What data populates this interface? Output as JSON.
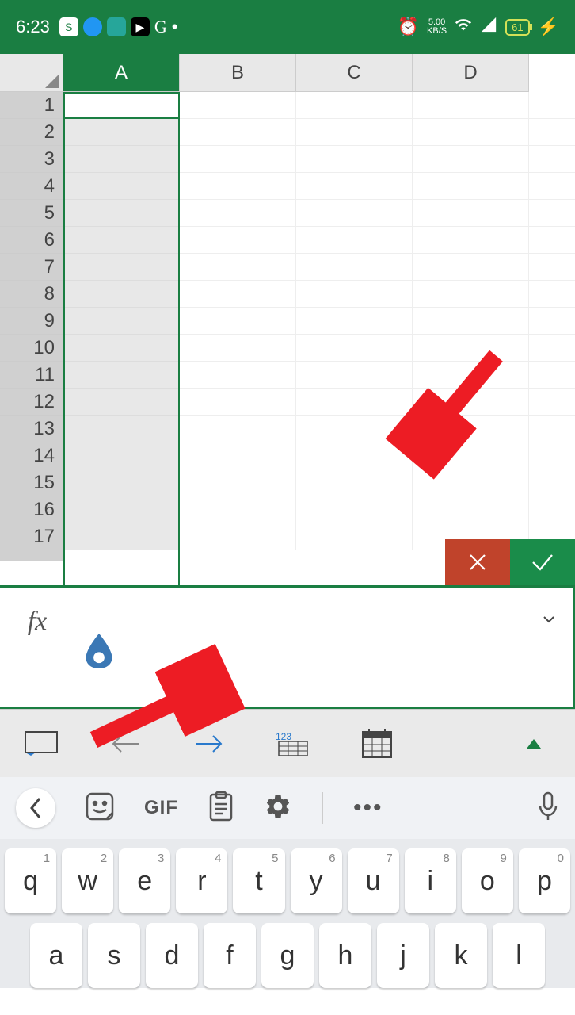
{
  "status_bar": {
    "time": "6:23",
    "icons": [
      "S",
      "leaf",
      "square",
      "play",
      "G"
    ],
    "net_speed_value": "5.00",
    "net_speed_unit": "KB/S",
    "battery": "61"
  },
  "spreadsheet": {
    "columns": [
      "A",
      "B",
      "C",
      "D"
    ],
    "selected_column": "A",
    "rows": [
      1,
      2,
      3,
      4,
      5,
      6,
      7,
      8,
      9,
      10,
      11,
      12,
      13,
      14,
      15,
      16,
      17
    ],
    "active_cell": "A1"
  },
  "formula_bar": {
    "fx_label": "fx",
    "value": ""
  },
  "toolbar": {
    "items": [
      "keyboard-mode",
      "nav-left",
      "nav-right",
      "num-pad",
      "date-picker"
    ]
  },
  "keyboard_bar": {
    "gif_label": "GIF"
  },
  "keyboard": {
    "row1": [
      {
        "key": "q",
        "num": "1"
      },
      {
        "key": "w",
        "num": "2"
      },
      {
        "key": "e",
        "num": "3"
      },
      {
        "key": "r",
        "num": "4"
      },
      {
        "key": "t",
        "num": "5"
      },
      {
        "key": "y",
        "num": "6"
      },
      {
        "key": "u",
        "num": "7"
      },
      {
        "key": "i",
        "num": "8"
      },
      {
        "key": "o",
        "num": "9"
      },
      {
        "key": "p",
        "num": "0"
      }
    ],
    "row2": [
      {
        "key": "a"
      },
      {
        "key": "s"
      },
      {
        "key": "d"
      },
      {
        "key": "f"
      },
      {
        "key": "g"
      },
      {
        "key": "h"
      },
      {
        "key": "j"
      },
      {
        "key": "k"
      },
      {
        "key": "l"
      }
    ]
  },
  "colors": {
    "primary_green": "#1a7e42",
    "cancel_red": "#c0432b",
    "accept_green": "#1a8c4a",
    "arrow_red": "#ed1c24"
  }
}
